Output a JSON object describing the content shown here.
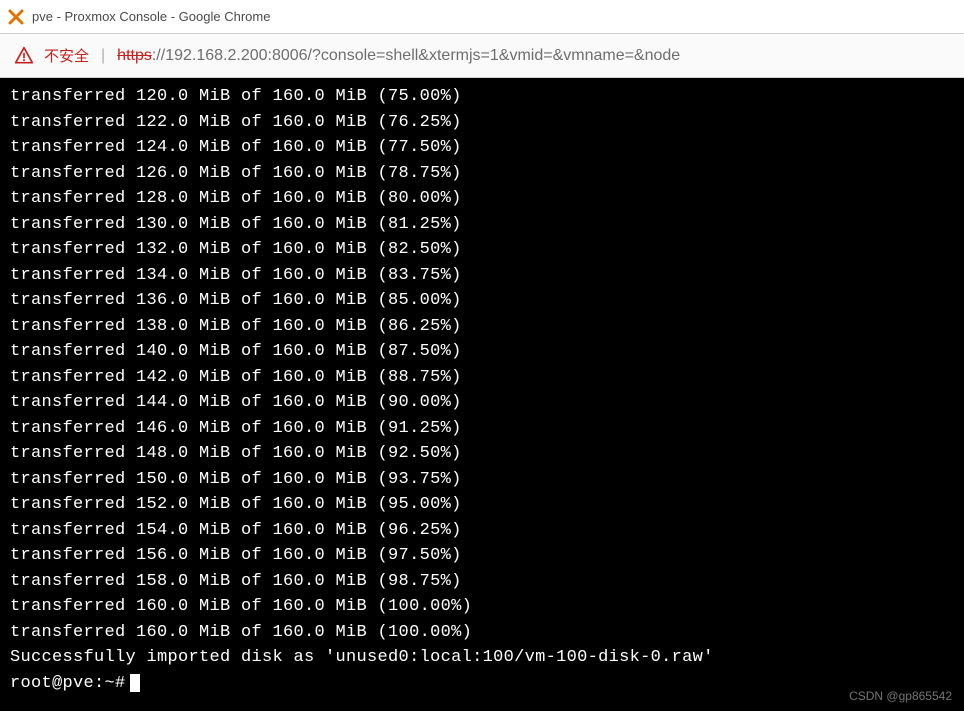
{
  "window": {
    "title": "pve - Proxmox Console - Google Chrome"
  },
  "addressbar": {
    "not_secure_label": "不安全",
    "url_scheme": "https",
    "url_rest": "://192.168.2.200:8006/?console=shell&xtermjs=1&vmid=&vmname=&node"
  },
  "console": {
    "total_mib": "160.0",
    "lines": [
      {
        "mib": "120.0",
        "pct": "75.00%"
      },
      {
        "mib": "122.0",
        "pct": "76.25%"
      },
      {
        "mib": "124.0",
        "pct": "77.50%"
      },
      {
        "mib": "126.0",
        "pct": "78.75%"
      },
      {
        "mib": "128.0",
        "pct": "80.00%"
      },
      {
        "mib": "130.0",
        "pct": "81.25%"
      },
      {
        "mib": "132.0",
        "pct": "82.50%"
      },
      {
        "mib": "134.0",
        "pct": "83.75%"
      },
      {
        "mib": "136.0",
        "pct": "85.00%"
      },
      {
        "mib": "138.0",
        "pct": "86.25%"
      },
      {
        "mib": "140.0",
        "pct": "87.50%"
      },
      {
        "mib": "142.0",
        "pct": "88.75%"
      },
      {
        "mib": "144.0",
        "pct": "90.00%"
      },
      {
        "mib": "146.0",
        "pct": "91.25%"
      },
      {
        "mib": "148.0",
        "pct": "92.50%"
      },
      {
        "mib": "150.0",
        "pct": "93.75%"
      },
      {
        "mib": "152.0",
        "pct": "95.00%"
      },
      {
        "mib": "154.0",
        "pct": "96.25%"
      },
      {
        "mib": "156.0",
        "pct": "97.50%"
      },
      {
        "mib": "158.0",
        "pct": "98.75%"
      },
      {
        "mib": "160.0",
        "pct": "100.00%"
      },
      {
        "mib": "160.0",
        "pct": "100.00%"
      }
    ],
    "success_line": "Successfully imported disk as 'unused0:local:100/vm-100-disk-0.raw'",
    "prompt": "root@pve:~#"
  },
  "watermark": "CSDN @gp865542"
}
